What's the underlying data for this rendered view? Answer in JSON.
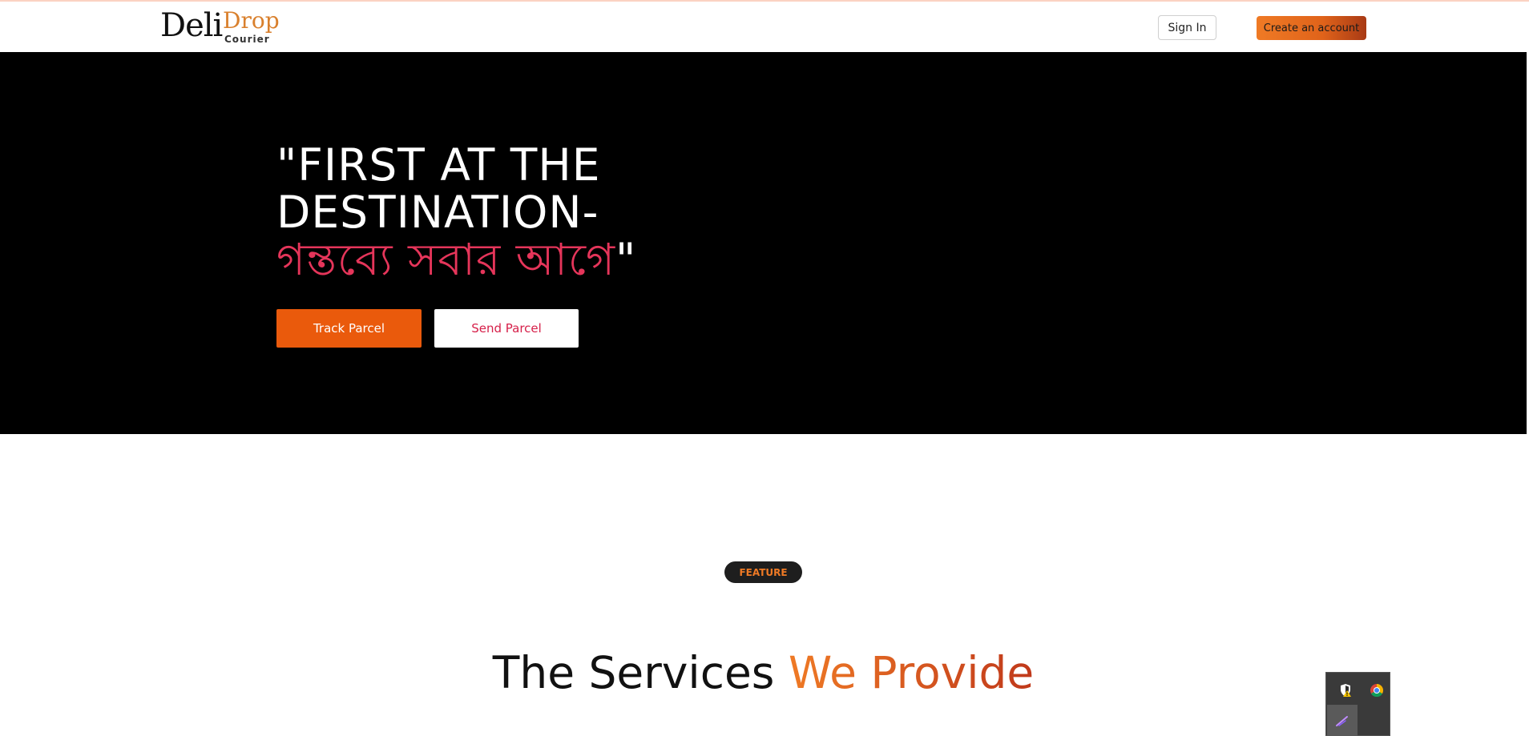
{
  "navbar": {
    "logo": {
      "deli": "Deli",
      "drop": "Drop",
      "courier": "Courier"
    },
    "signin_label": "Sign In",
    "create_account_label": "Create an account"
  },
  "hero": {
    "title_line1": "\"FIRST AT THE",
    "title_line2": "DESTINATION-",
    "title_bangla": "গন্তব্যে সবার আগে",
    "title_close_quote": "\"",
    "track_label": "Track Parcel",
    "send_label": "Send Parcel"
  },
  "features": {
    "badge": "FEATURE",
    "title_plain": "The Services ",
    "title_accent": "We Provide"
  },
  "tray": {
    "icons": [
      "security-warning-icon",
      "chrome-icon",
      "pen-icon"
    ]
  },
  "colors": {
    "brand_orange": "#ea5a0c",
    "accent_pink": "#e5355a",
    "logo_gold": "#d9802d"
  }
}
